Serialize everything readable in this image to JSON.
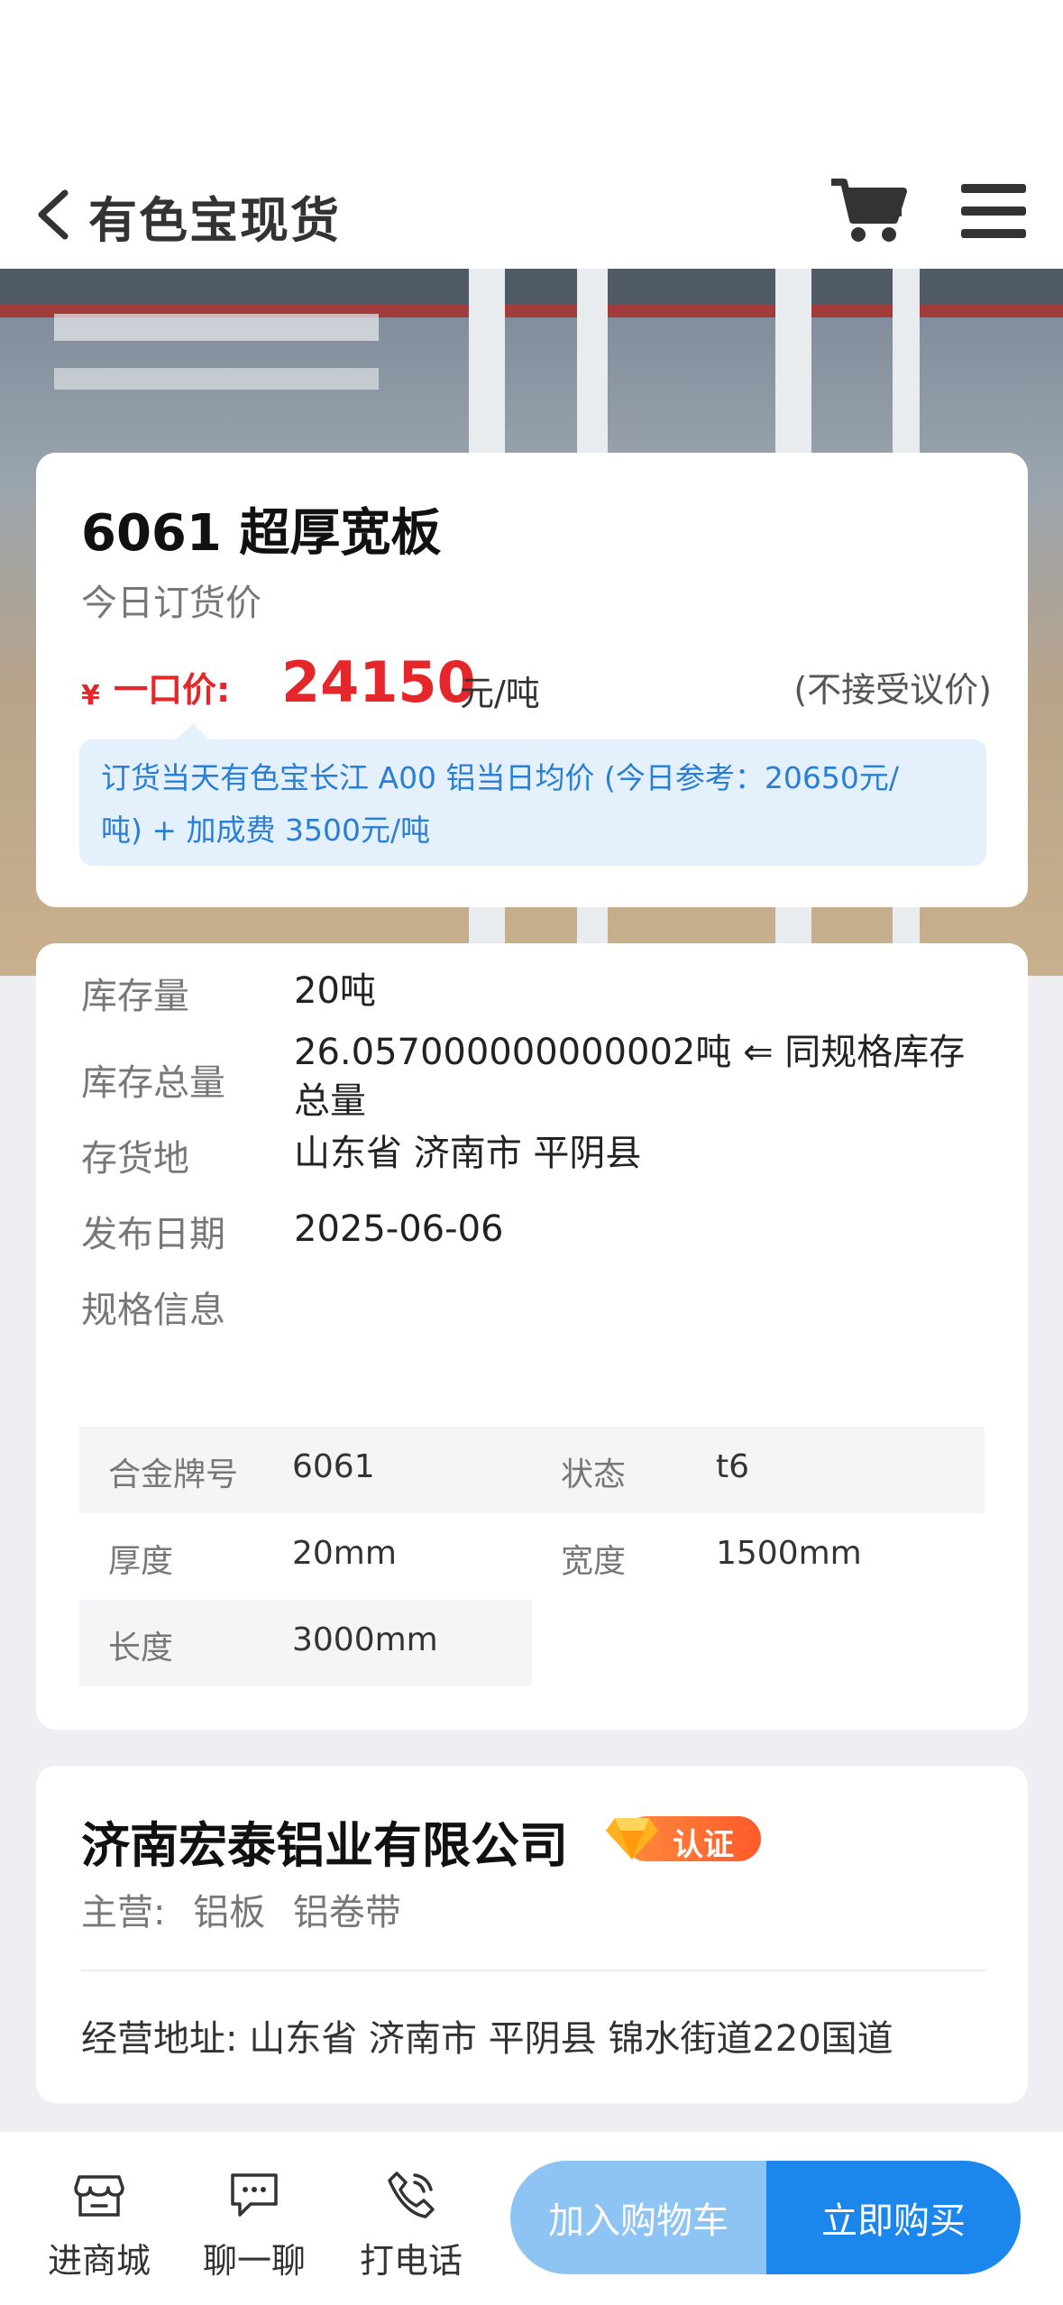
{
  "header": {
    "title": "有色宝现货"
  },
  "product": {
    "title": "6061 超厚宽板",
    "price_caption": "今日订货价",
    "currency_symbol": "¥",
    "price_label": "一口价:",
    "price_value": "24150",
    "price_unit": "元/吨",
    "negotiation_note": "(不接受议价)",
    "formula_line1": "订货当天有色宝长江 A00 铝当日均价 (今日参考：20650元/",
    "formula_line2": "吨) + 加成费 3500元/吨"
  },
  "info": {
    "stock_label": "库存量",
    "stock_value": "20吨",
    "total_stock_label": "库存总量",
    "total_stock_value": "26.057000000000002吨 ⇐ 同规格库存总量",
    "location_label": "存货地",
    "location_value": "山东省 济南市 平阴县",
    "date_label": "发布日期",
    "date_value": "2025-06-06",
    "spec_label": "规格信息",
    "specs": [
      {
        "key": "合金牌号",
        "value": "6061"
      },
      {
        "key": "状态",
        "value": "t6"
      },
      {
        "key": "厚度",
        "value": "20mm"
      },
      {
        "key": "宽度",
        "value": "1500mm"
      },
      {
        "key": "长度",
        "value": "3000mm"
      }
    ]
  },
  "company": {
    "name": "济南宏泰铝业有限公司",
    "cert_label": "认证",
    "main_prefix": "主营:",
    "main_items": [
      "铝板",
      "铝卷带"
    ],
    "address": "经营地址:  山东省 济南市 平阴县 锦水街道220国道"
  },
  "bottom": {
    "store_label": "进商城",
    "chat_label": "聊一聊",
    "call_label": "打电话",
    "add_cart_label": "加入购物车",
    "buy_label": "立即购买"
  },
  "colors": {
    "accent": "#1b86ec",
    "price": "#e5262b",
    "cert": "#ff6a30"
  }
}
